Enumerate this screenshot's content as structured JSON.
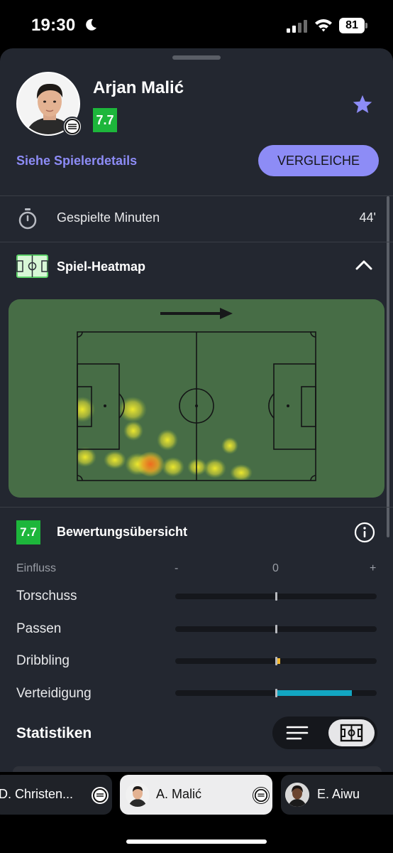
{
  "status_bar": {
    "time": "19:30",
    "battery": "81"
  },
  "header": {
    "player_name": "Arjan Malić",
    "rating": "7.7",
    "details_link": "Siehe Spielerdetails",
    "compare_button": "VERGLEICHE"
  },
  "minutes": {
    "label": "Gespielte Minuten",
    "value": "44'"
  },
  "heatmap": {
    "title": "Spiel-Heatmap",
    "attack_direction": "right"
  },
  "rating_overview": {
    "rating": "7.7",
    "title": "Bewertungsübersicht",
    "axis": {
      "label": "Einfluss",
      "minus": "-",
      "zero": "0",
      "plus": "+"
    },
    "metrics": [
      {
        "label": "Torschuss",
        "impact": 0.0,
        "color": ""
      },
      {
        "label": "Passen",
        "impact": 0.0,
        "color": ""
      },
      {
        "label": "Dribbling",
        "impact": 0.03,
        "color": "#f5b82e"
      },
      {
        "label": "Verteidigung",
        "impact": 0.74,
        "color": "#12a6c2"
      }
    ]
  },
  "statistics": {
    "title": "Statistiken",
    "active_view": "pitch"
  },
  "player_tabs": [
    {
      "name": "D. Christen..."
    },
    {
      "name": "A. Malić",
      "active": true
    },
    {
      "name": "E. Aiwu"
    }
  ]
}
